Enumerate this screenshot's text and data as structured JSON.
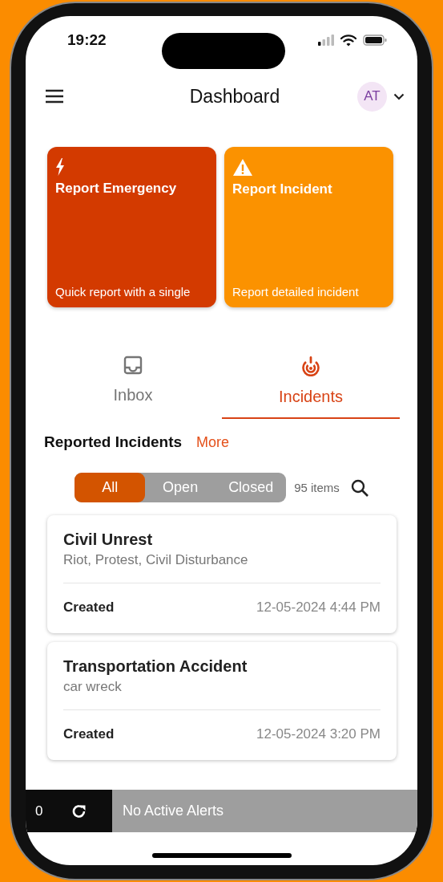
{
  "status_bar": {
    "time": "19:22"
  },
  "header": {
    "title": "Dashboard",
    "avatar": "AT"
  },
  "action_cards": [
    {
      "kind": "emergency",
      "title": "Report Emergency",
      "subtitle": "Quick report with a single",
      "color": "#d33a00"
    },
    {
      "kind": "incident",
      "title": "Report Incident",
      "subtitle": "Report detailed incident",
      "color": "#fb9200"
    }
  ],
  "tabs": [
    {
      "kind": "inbox",
      "label": "Inbox",
      "selected": false
    },
    {
      "kind": "incidents",
      "label": "Incidents",
      "selected": true
    }
  ],
  "section": {
    "title": "Reported Incidents",
    "link": "More"
  },
  "filters": [
    {
      "label": "All",
      "selected": true
    },
    {
      "label": "Open",
      "selected": false
    },
    {
      "label": "Closed",
      "selected": false
    }
  ],
  "item_count": "95 items",
  "incidents": [
    {
      "title": "Civil Unrest",
      "tags": "Riot, Protest, Civil Disturbance",
      "status": "Created",
      "date": "12-05-2024 4:44 PM"
    },
    {
      "title": "Transportation Accident",
      "tags": "car wreck",
      "status": "Created",
      "date": "12-05-2024 3:20 PM"
    }
  ],
  "alert_bar": {
    "count": "0",
    "message": "No Active Alerts"
  }
}
